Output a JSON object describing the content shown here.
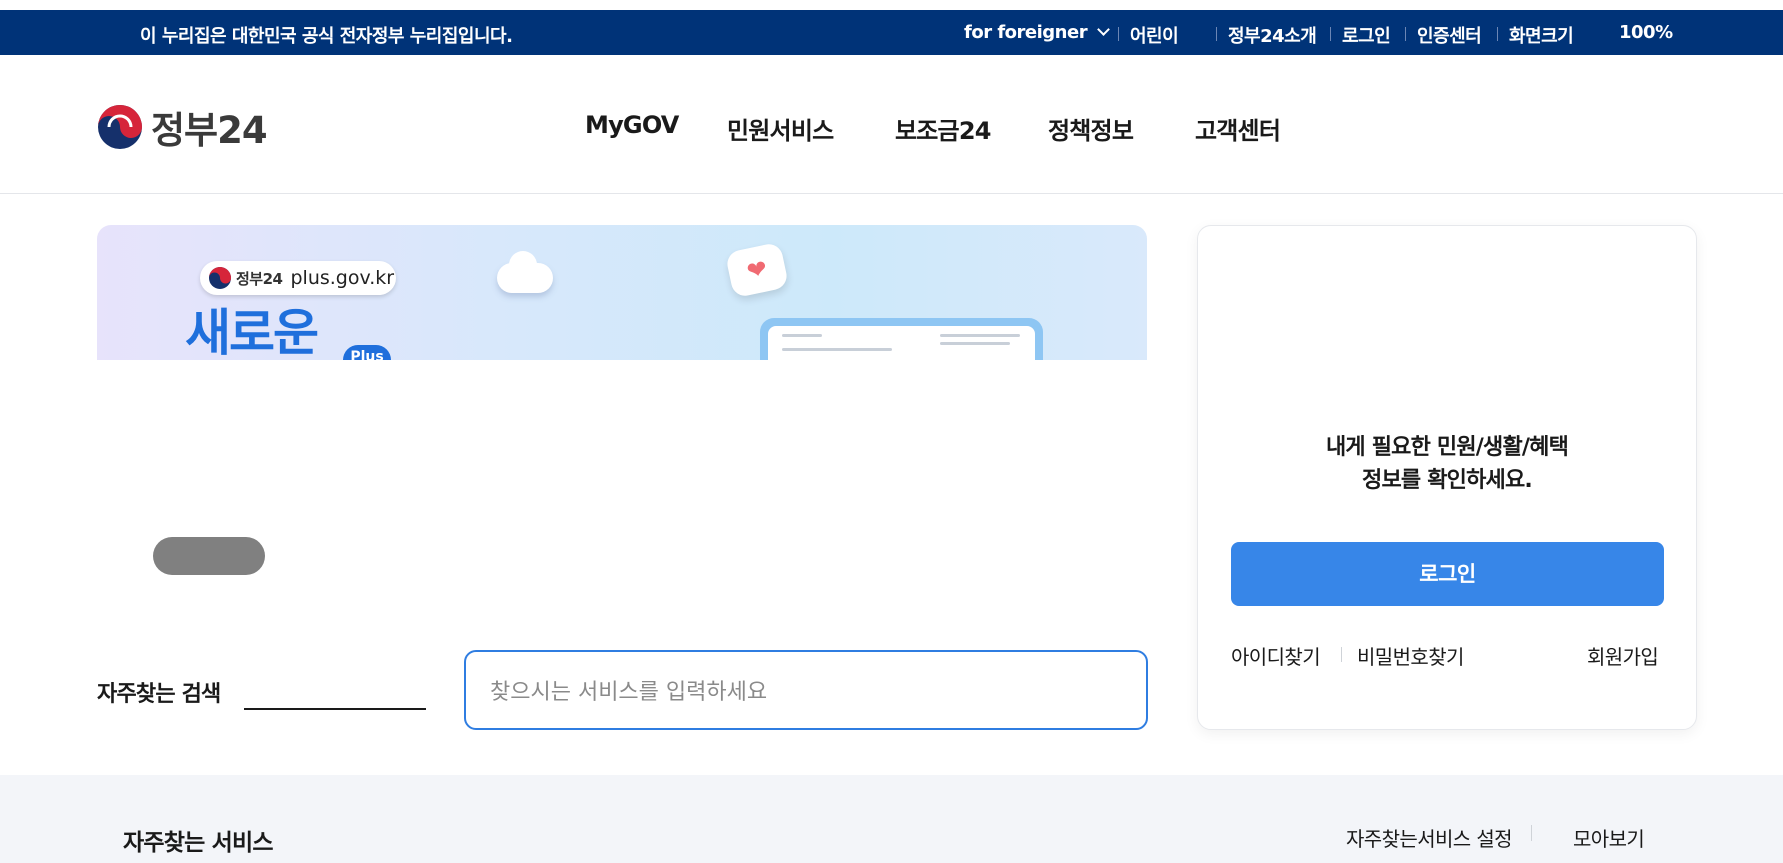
{
  "topbar": {
    "notice": "이 누리집은 대한민국 공식 전자정부 누리집입니다.",
    "foreigner": "for foreigner",
    "kids": "어린이",
    "about": "정부24소개",
    "login": "로그인",
    "cert": "인증센터",
    "screen_size": "화면크기",
    "zoom": "100%"
  },
  "header": {
    "logo_text": "정부24",
    "nav": [
      "MyGOV",
      "민원서비스",
      "보조금24",
      "정책정보",
      "고객센터"
    ]
  },
  "banner": {
    "brand": "정부24",
    "url": "plus.gov.kr",
    "headline": "새로운",
    "tag": "Plus"
  },
  "search": {
    "label": "자주찾는 검색",
    "placeholder": "찾으시는 서비스를 입력하세요"
  },
  "login_panel": {
    "message_line1": "내게 필요한 민원/생활/혜택",
    "message_line2": "정보를 확인하세요.",
    "login_button": "로그인",
    "find_id": "아이디찾기",
    "find_password": "비밀번호찾기",
    "signup": "회원가입"
  },
  "frequent_services": {
    "title": "자주찾는 서비스",
    "settings": "자주찾는서비스 설정",
    "view_all": "모아보기"
  },
  "colors": {
    "topbar_bg": "#003378",
    "primary_blue": "#3786e8",
    "search_border": "#2f7de1"
  }
}
